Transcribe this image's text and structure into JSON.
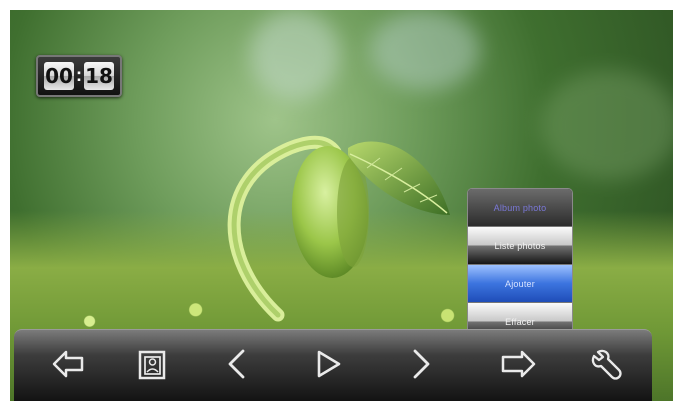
{
  "timer": {
    "minutes": "00",
    "separator": ":",
    "seconds": "18"
  },
  "menu": {
    "items": [
      {
        "label": "Album photo",
        "state": "header"
      },
      {
        "label": "Liste photos",
        "state": "normal"
      },
      {
        "label": "Ajouter",
        "state": "selected"
      },
      {
        "label": "Effacer",
        "state": "normal"
      }
    ]
  },
  "toolbar": {
    "buttons": [
      {
        "icon": "back-arrow-icon"
      },
      {
        "icon": "photo-frame-icon"
      },
      {
        "icon": "chevron-left-icon"
      },
      {
        "icon": "play-icon"
      },
      {
        "icon": "chevron-right-icon"
      },
      {
        "icon": "export-arrow-icon"
      },
      {
        "icon": "wrench-icon"
      }
    ]
  },
  "colors": {
    "menu_selected": "#3c74df",
    "menu_header_text": "#7a78d8",
    "toolbar_bg": "#131313"
  }
}
